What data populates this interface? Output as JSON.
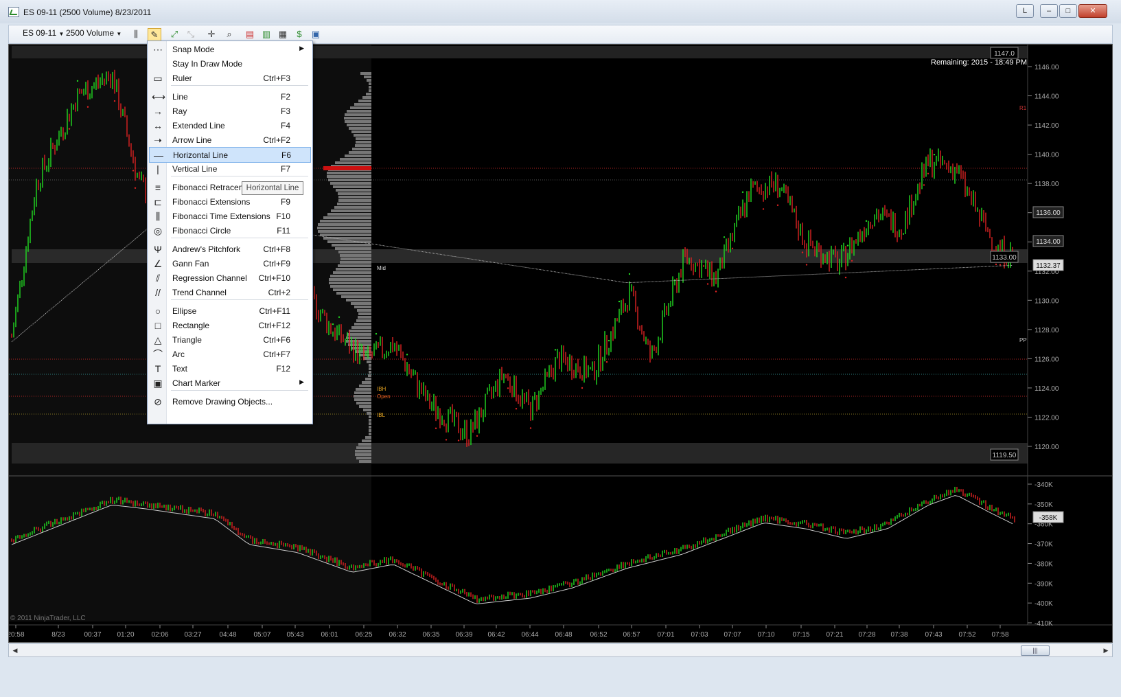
{
  "window": {
    "title": "ES 09-11 (2500 Volume)  8/23/2011",
    "btn_l": "L",
    "btn_min": "–",
    "btn_max": "□",
    "btn_close": "✕"
  },
  "toolbar": {
    "instrument": "ES 09-11",
    "period": "2500 Volume"
  },
  "chart": {
    "remaining": "Remaining: 2015 - 18:49 PM",
    "copyright": "© 2011 NinjaTrader, LLC",
    "price_axis": [
      "1146.00",
      "1144.00",
      "1142.00",
      "1140.00",
      "1138.00",
      "1136.00",
      "1134.00",
      "1132.00",
      "1130.00",
      "1128.00",
      "1126.00",
      "1124.00",
      "1122.00",
      "1120.00"
    ],
    "price_tags": {
      "current": "1136.00",
      "box1134": "1134.00",
      "last": "1132.37",
      "p1147": "1147.0",
      "p1133": "1133.00",
      "p1119": "1119.50"
    },
    "vol_axis": [
      "-340K",
      "-350K",
      "-360K",
      "-370K",
      "-380K",
      "-390K",
      "-400K",
      "-410K"
    ],
    "vol_tag": "-358K",
    "time_axis": [
      "20:58",
      "8/23",
      "00:37",
      "01:20",
      "02:06",
      "03:27",
      "04:48",
      "05:07",
      "05:43",
      "06:01",
      "06:25",
      "06:32",
      "06:35",
      "06:39",
      "06:42",
      "06:44",
      "06:48",
      "06:52",
      "06:57",
      "07:01",
      "07:03",
      "07:07",
      "07:10",
      "07:15",
      "07:21",
      "07:28",
      "07:38",
      "07:43",
      "07:52",
      "07:58"
    ],
    "labels": {
      "mid": "Mid",
      "ibh": "IBH",
      "open": "Open",
      "ibl": "IBL",
      "r1": "R1",
      "pp": "PP"
    }
  },
  "menu": {
    "items": [
      {
        "label": "Snap Mode",
        "shortcut": "",
        "icon": "snap-icon",
        "sub": true
      },
      {
        "label": "Stay In Draw Mode",
        "shortcut": "",
        "icon": "",
        "sub": false
      },
      {
        "label": "Ruler",
        "shortcut": "Ctrl+F3",
        "icon": "ruler-icon",
        "sub": false
      },
      {
        "label": "Line",
        "shortcut": "F2",
        "icon": "line-icon",
        "sub": false
      },
      {
        "label": "Ray",
        "shortcut": "F3",
        "icon": "ray-icon",
        "sub": false
      },
      {
        "label": "Extended Line",
        "shortcut": "F4",
        "icon": "extended-line-icon",
        "sub": false
      },
      {
        "label": "Arrow Line",
        "shortcut": "Ctrl+F2",
        "icon": "arrow-line-icon",
        "sub": false
      },
      {
        "label": "Horizontal Line",
        "shortcut": "F6",
        "icon": "horizontal-line-icon",
        "sub": false
      },
      {
        "label": "Vertical Line",
        "shortcut": "F7",
        "icon": "vertical-line-icon",
        "sub": false
      },
      {
        "label": "Fibonacci Retracem",
        "shortcut": "",
        "icon": "fib-retracement-icon",
        "sub": false
      },
      {
        "label": "Fibonacci Extensions",
        "shortcut": "F9",
        "icon": "fib-extensions-icon",
        "sub": false
      },
      {
        "label": "Fibonacci Time Extensions",
        "shortcut": "F10",
        "icon": "fib-time-icon",
        "sub": false
      },
      {
        "label": "Fibonacci Circle",
        "shortcut": "F11",
        "icon": "fib-circle-icon",
        "sub": false
      },
      {
        "label": "Andrew's Pitchfork",
        "shortcut": "Ctrl+F8",
        "icon": "pitchfork-icon",
        "sub": false
      },
      {
        "label": "Gann Fan",
        "shortcut": "Ctrl+F9",
        "icon": "gann-fan-icon",
        "sub": false
      },
      {
        "label": "Regression Channel",
        "shortcut": "Ctrl+F10",
        "icon": "regression-icon",
        "sub": false
      },
      {
        "label": "Trend Channel",
        "shortcut": "Ctrl+2",
        "icon": "trend-channel-icon",
        "sub": false
      },
      {
        "label": "Ellipse",
        "shortcut": "Ctrl+F11",
        "icon": "ellipse-icon",
        "sub": false
      },
      {
        "label": "Rectangle",
        "shortcut": "Ctrl+F12",
        "icon": "rectangle-icon",
        "sub": false
      },
      {
        "label": "Triangle",
        "shortcut": "Ctrl+F6",
        "icon": "triangle-icon",
        "sub": false
      },
      {
        "label": "Arc",
        "shortcut": "Ctrl+F7",
        "icon": "arc-icon",
        "sub": false
      },
      {
        "label": "Text",
        "shortcut": "F12",
        "icon": "text-icon",
        "sub": false
      },
      {
        "label": "Chart Marker",
        "shortcut": "",
        "icon": "chart-marker-icon",
        "sub": true
      },
      {
        "label": "Remove Drawing Objects...",
        "shortcut": "",
        "icon": "remove-icon",
        "sub": false
      }
    ],
    "tooltip": "Horizontal Line"
  },
  "colors": {
    "up": "#22dd22",
    "down": "#dd2222",
    "bg": "#000000",
    "axis": "#888888",
    "highlight": "#cfe4fb"
  }
}
